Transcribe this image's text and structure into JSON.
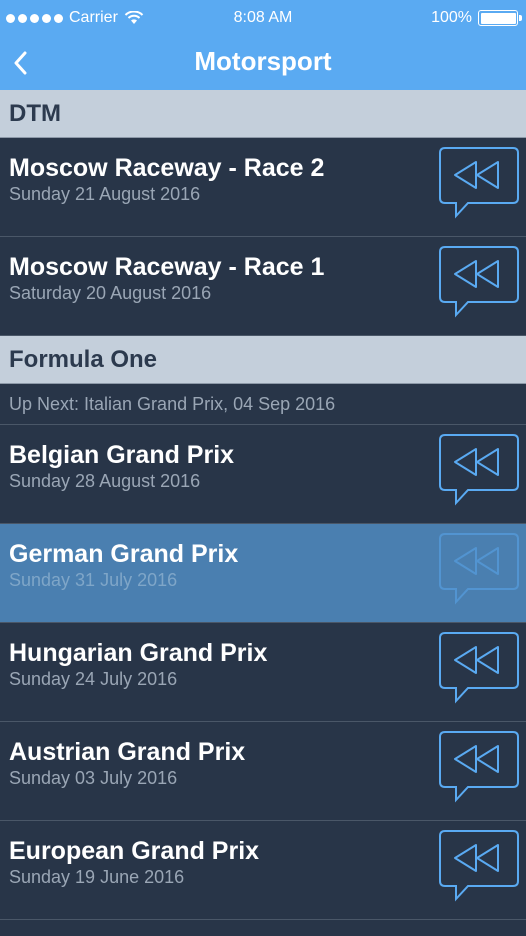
{
  "status_bar": {
    "carrier": "Carrier",
    "time": "8:08 AM",
    "battery": "100%",
    "battery_level": 1.0
  },
  "nav": {
    "title": "Motorsport",
    "back_icon": "chevron-left-icon"
  },
  "colors": {
    "nav_bg": "#5aaaf2",
    "list_bg": "#283548",
    "section_bg": "#c4cfdb",
    "selected_bg": "#4a7fb0",
    "accent": "#5aaaf2"
  },
  "sections": [
    {
      "title": "DTM",
      "races": [
        {
          "name": "Moscow Raceway - Race 2",
          "date": "Sunday 21 August 2016"
        },
        {
          "name": "Moscow Raceway - Race 1",
          "date": "Saturday 20 August 2016"
        }
      ]
    },
    {
      "title": "Formula One",
      "up_next": "Up Next: Italian Grand Prix, 04 Sep 2016",
      "races": [
        {
          "name": "Belgian Grand Prix",
          "date": "Sunday 28 August 2016"
        },
        {
          "name": "German Grand Prix",
          "date": "Sunday 31 July 2016",
          "selected": true
        },
        {
          "name": "Hungarian Grand Prix",
          "date": "Sunday 24 July 2016"
        },
        {
          "name": "Austrian Grand Prix",
          "date": "Sunday 03 July 2016"
        },
        {
          "name": "European Grand Prix",
          "date": "Sunday 19 June 2016"
        }
      ]
    }
  ],
  "replay_icon": "replay-speech-bubble-icon"
}
